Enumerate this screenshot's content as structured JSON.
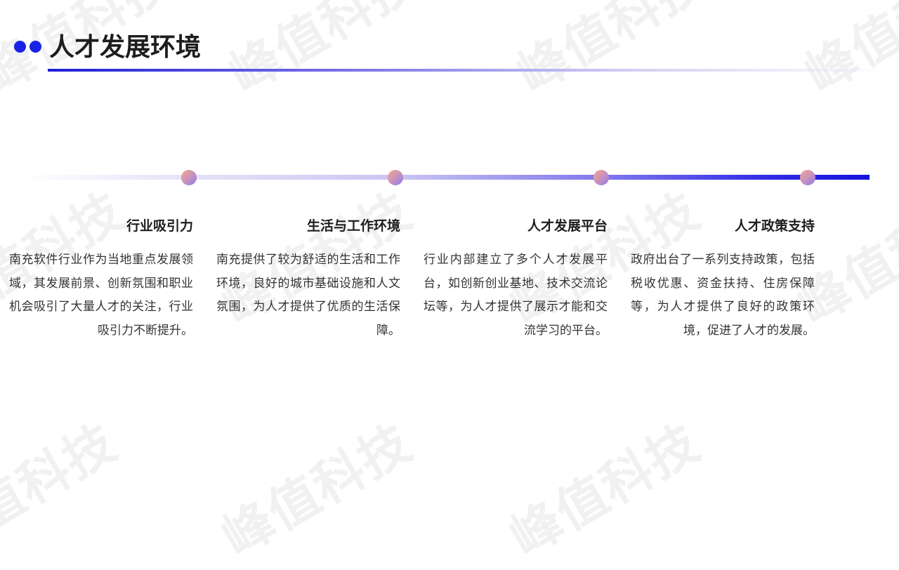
{
  "page": {
    "title": "人才发展环境"
  },
  "watermark": {
    "text": "峰值科技"
  },
  "colors": {
    "accent": "#1a22e6",
    "node_gradient_start": "#f4a98a",
    "node_gradient_end": "#8a7df0"
  },
  "timeline": {
    "items": [
      {
        "title": "行业吸引力",
        "body": "南充软件行业作为当地重点发展领域，其发展前景、创新氛围和职业机会吸引了大量人才的关注，行业吸引力不断提升。"
      },
      {
        "title": "生活与工作环境",
        "body": "南充提供了较为舒适的生活和工作环境，良好的城市基础设施和人文氛围，为人才提供了优质的生活保障。"
      },
      {
        "title": "人才发展平台",
        "body": "行业内部建立了多个人才发展平台，如创新创业基地、技术交流论坛等，为人才提供了展示才能和交流学习的平台。"
      },
      {
        "title": "人才政策支持",
        "body": "政府出台了一系列支持政策，包括税收优惠、资金扶持、住房保障等，为人才提供了良好的政策环境，促进了人才的发展。"
      }
    ]
  }
}
